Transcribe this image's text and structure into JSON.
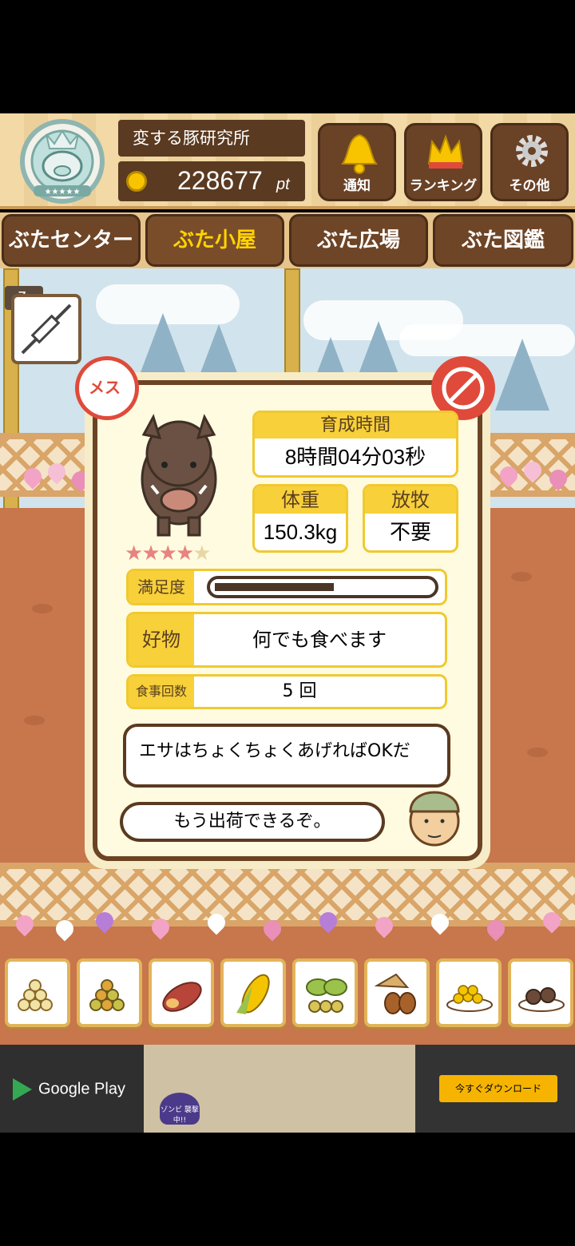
{
  "header": {
    "lab_name": "変する豚研究所",
    "points_value": "228677",
    "points_unit": "pt",
    "buttons": {
      "notify": "通知",
      "ranking": "ランキング",
      "other": "その他"
    }
  },
  "tabs": [
    "ぶたセンター",
    "ぶた小屋",
    "ぶた広場",
    "ぶた図鑑"
  ],
  "active_tab": "ぶた小屋",
  "syringe_count": "7",
  "pig": {
    "gender_label": "メス",
    "stars_total": 5,
    "stars_filled": 4,
    "growth_time_label": "育成時間",
    "growth_time_value": "8時間04分03秒",
    "weight_label": "体重",
    "weight_value": "150.3kg",
    "grazing_label": "放牧",
    "grazing_value": "不要",
    "satisfaction_label": "満足度",
    "satisfaction_level": 0.55,
    "favorite_label": "好物",
    "favorite_value": "何でも食べます",
    "meal_count_label": "食事回数",
    "meal_count_value": "5 回"
  },
  "dialog": {
    "line1": "エサはちょくちょくあげればOKだ",
    "line2": "もう出荷できるぞ。"
  },
  "ad": {
    "store": "Google Play",
    "button": "今すぐダウンロード",
    "badge": "ゾンビ 襲撃中!!"
  },
  "colors": {
    "wood": "#6e4526",
    "accent_yellow": "#f7d03a",
    "female_red": "#e04a3a",
    "ground": "#c8764b"
  }
}
